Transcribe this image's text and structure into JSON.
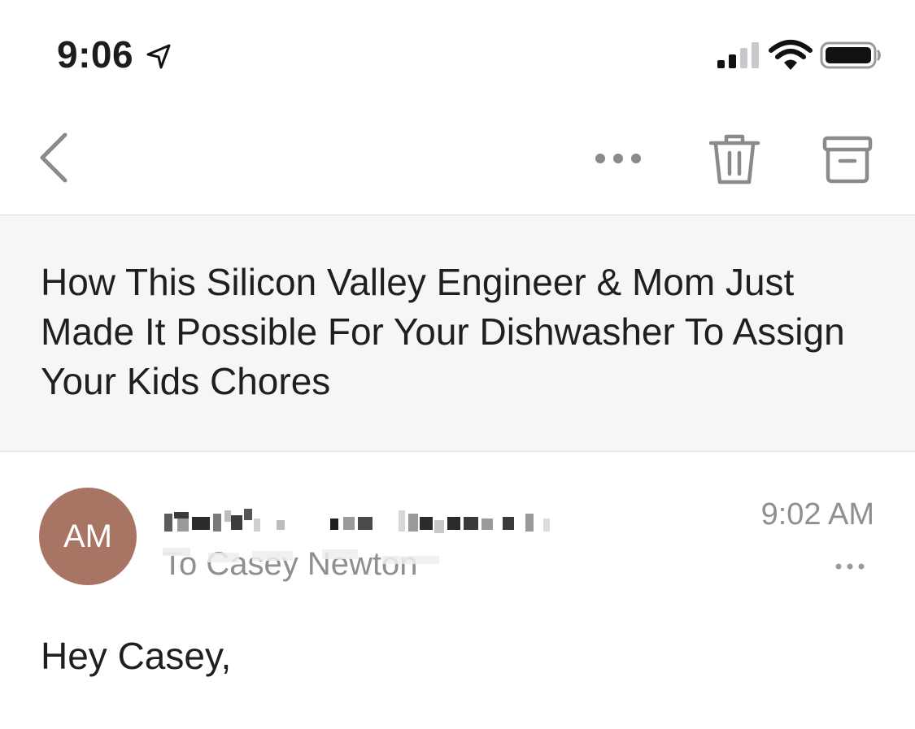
{
  "status_bar": {
    "time": "9:06",
    "icons": [
      "location-arrow-icon",
      "cellular-signal-icon",
      "wifi-icon",
      "battery-icon"
    ]
  },
  "nav_bar": {
    "icons": [
      "back-chevron-icon",
      "more-dots-icon",
      "trash-icon",
      "archive-icon"
    ]
  },
  "email": {
    "subject": "How This Silicon Valley Engineer & Mom Just Made It Possible For Your Dishwasher To Assign Your Kids Chores",
    "sender_initials": "AM",
    "sender_name": "",
    "recipients": "To Casey Newton",
    "time": "9:02 AM",
    "greeting": "Hey Casey,"
  },
  "colors": {
    "avatar_bg": "#a87565",
    "subject_bg": "#f6f6f6",
    "secondary_text": "#8e8e93"
  }
}
